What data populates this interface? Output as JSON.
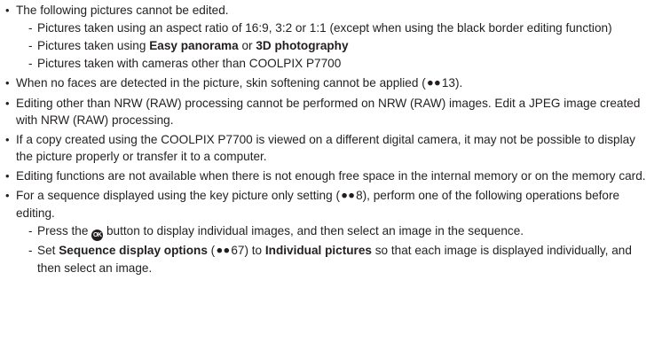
{
  "b1": "The following pictures cannot be edited.",
  "b1s1": "Pictures taken using an aspect ratio of 16:9, 3:2 or 1:1 (except when using the black border editing function)",
  "b1s2_a": "Pictures taken using ",
  "b1s2_b": "Easy panorama",
  "b1s2_c": " or ",
  "b1s2_d": "3D photography",
  "b1s3": "Pictures taken with cameras other than COOLPIX P7700",
  "b2_a": "When no faces are detected in the picture, skin softening cannot be applied (",
  "b2_ref": "13",
  "b2_b": ").",
  "b3": "Editing other than NRW (RAW) processing cannot be performed on NRW (RAW) images. Edit a JPEG image created with NRW (RAW) processing.",
  "b4": "If a copy created using the COOLPIX P7700 is viewed on a different digital camera, it may not be possible to display the picture properly or transfer it to a computer.",
  "b5": "Editing functions are not available when there is not enough free space in the internal memory or on the memory card.",
  "b6_a": "For a sequence displayed using the key picture only setting (",
  "b6_ref": "8",
  "b6_b": "), perform one of the following operations before editing.",
  "b6s1_a": "Press the ",
  "b6s1_ok": "OK",
  "b6s1_b": " button to display individual images, and then select an image in the sequence.",
  "b6s2_a": "Set ",
  "b6s2_b": "Sequence display options",
  "b6s2_c": " (",
  "b6s2_ref": "67",
  "b6s2_d": ") to ",
  "b6s2_e": "Individual pictures",
  "b6s2_f": " so that each image is displayed individually, and then select an image.",
  "icons": {
    "reference": "reference-arrow-icon",
    "ok_button": "ok-button-icon"
  }
}
